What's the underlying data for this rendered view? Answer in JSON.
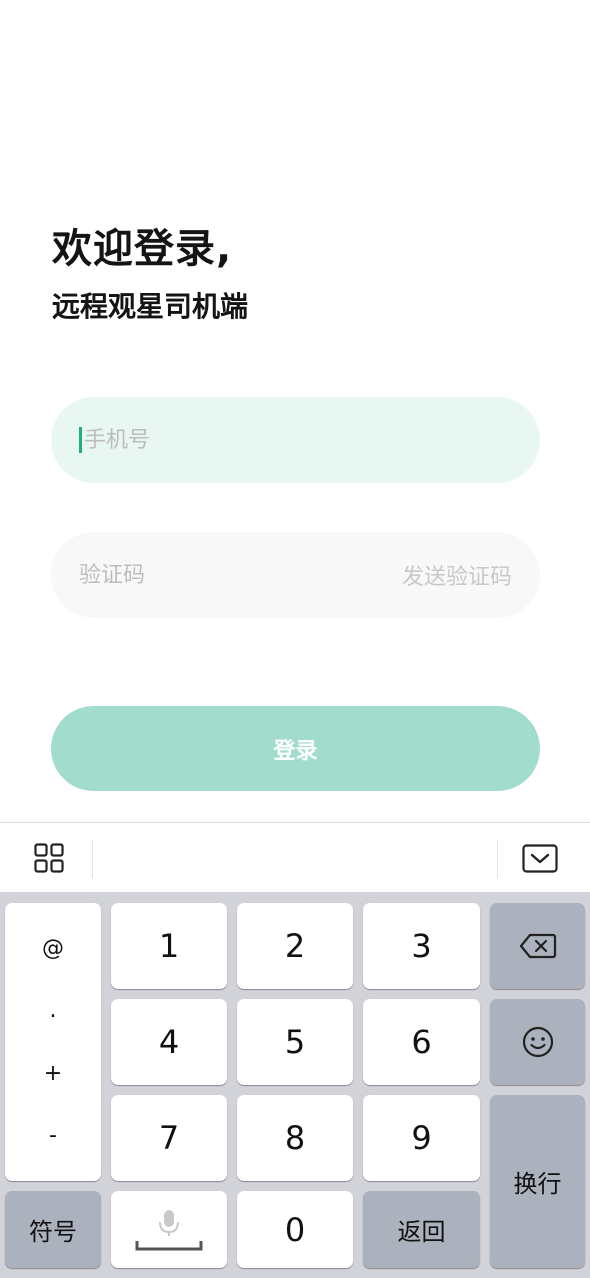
{
  "header": {
    "title": "欢迎登录,",
    "subtitle": "远程观星司机端"
  },
  "form": {
    "phone_placeholder": "手机号",
    "code_placeholder": "验证码",
    "send_code_label": "发送验证码",
    "login_label": "登录"
  },
  "keyboard": {
    "symbols": [
      "@",
      ".",
      "+",
      "-"
    ],
    "digits": [
      "1",
      "2",
      "3",
      "4",
      "5",
      "6",
      "7",
      "8",
      "9",
      "0"
    ],
    "symbol_key": "符号",
    "return_key": "返回",
    "newline_key": "换行"
  },
  "colors": {
    "accent": "#1fae83",
    "login_button": "#a2dccc",
    "phone_field_bg": "#e8f7f1",
    "code_field_bg": "#f8f8f8"
  },
  "icons": {
    "toolbar_left": "grid-icon",
    "toolbar_right": "keyboard-hide-icon",
    "backspace": "backspace-icon",
    "emoji": "emoji-icon",
    "microphone": "microphone-icon"
  }
}
